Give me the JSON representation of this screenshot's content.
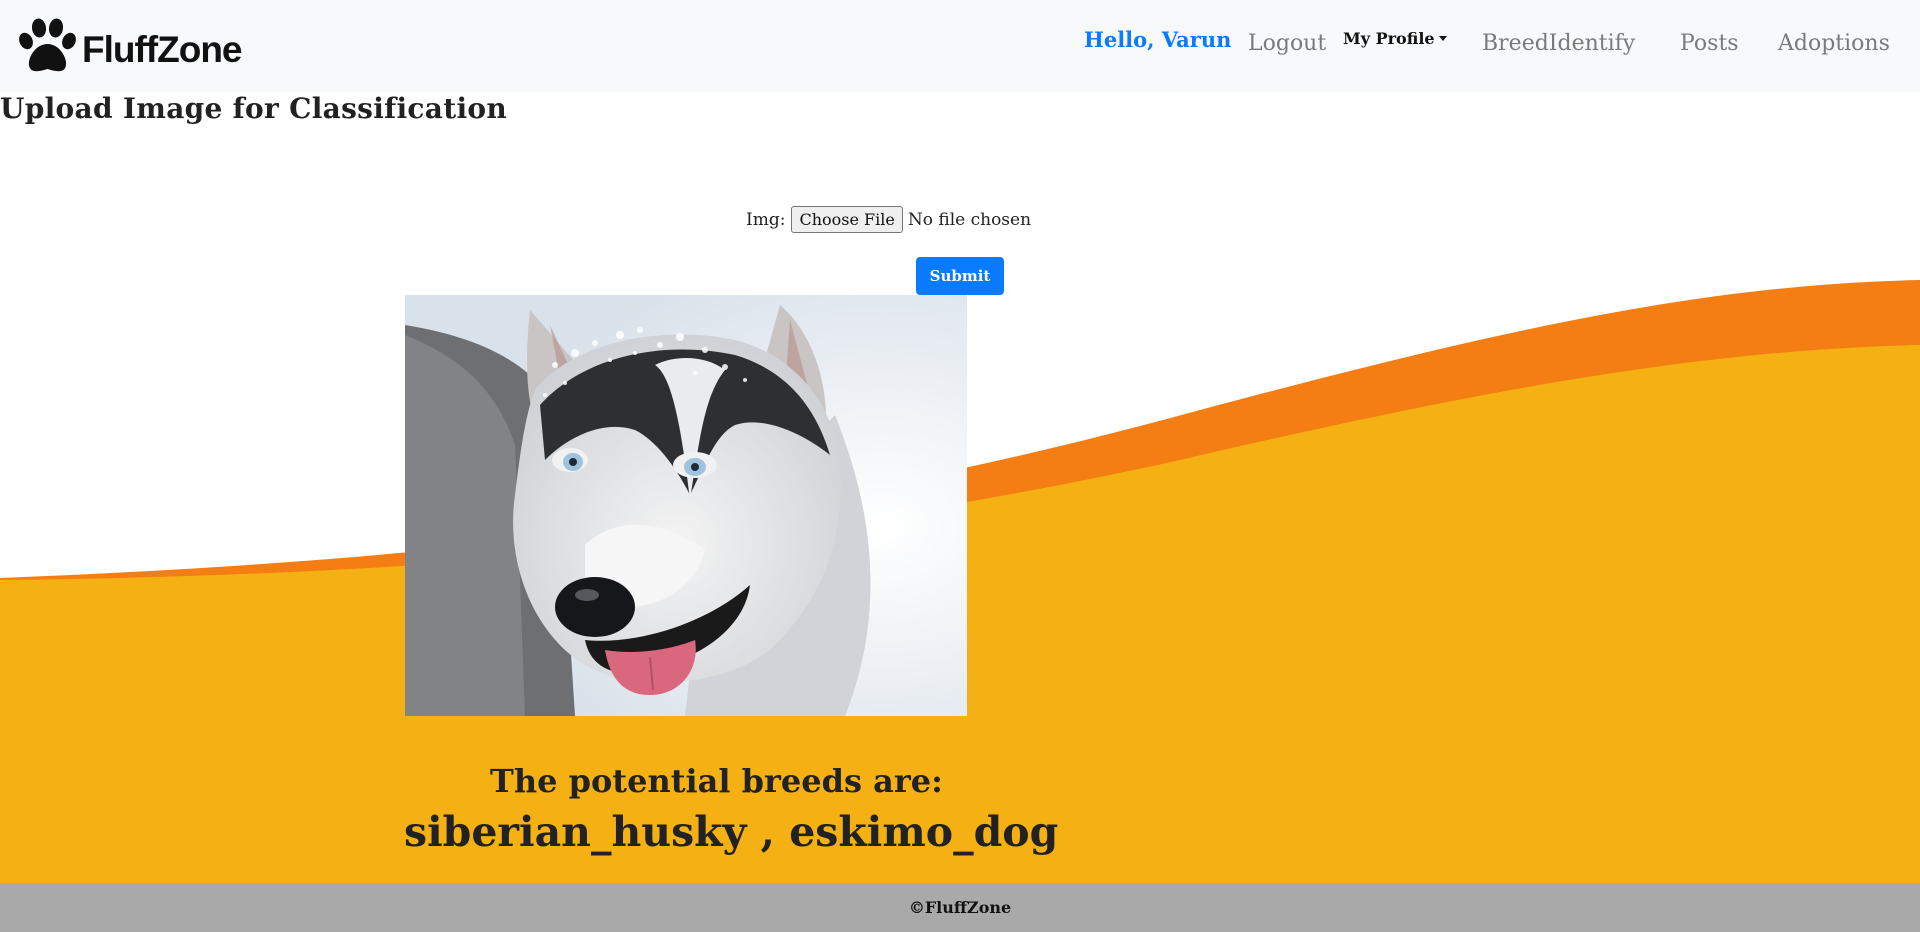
{
  "navbar": {
    "brand": "FluffZone",
    "greeting": "Hello, Varun",
    "logout": "Logout",
    "profile": "My Profile",
    "links": [
      "BreedIdentify",
      "Posts",
      "Adoptions"
    ]
  },
  "page": {
    "title": "Upload Image for Classification"
  },
  "form": {
    "img_label": "Img:",
    "file_button": "Choose File",
    "file_status": "No file chosen",
    "submit": "Submit"
  },
  "result": {
    "heading": "The potential breeds are:",
    "breeds": "siberian_husky , eskimo_dog"
  },
  "footer": {
    "text": "©FluffZone"
  },
  "colors": {
    "accent_blue": "#0a7bff",
    "wave_orange": "#f47d14",
    "wave_yellow": "#f5b013",
    "navbar_bg": "#f8f9fa",
    "footer_bg": "#a9a9a9"
  }
}
